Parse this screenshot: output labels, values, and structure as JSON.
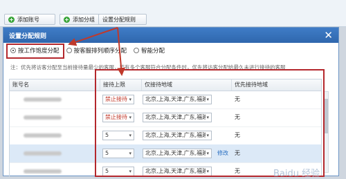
{
  "toolbar": {
    "add_account": "添加账号",
    "add_group": "添加分组",
    "set_rule": "设置分配规则"
  },
  "dialog": {
    "title": "设置分配规则",
    "close": "✕",
    "options": [
      "按工作饱度分配",
      "按客服排列顺序分配",
      "智能分配"
    ],
    "selected": 0,
    "note": "注：优先将访客分配至当前接待量最少的客服，若有多个客服符合分配条件时，优先将访客分配给最久未进行接待的客服"
  },
  "table": {
    "headers": [
      "账号名",
      "接待上限",
      "仅接待地域",
      "优先接待地域"
    ],
    "rows": [
      {
        "limit": "禁止接待",
        "limit_red": true,
        "region": "北京,上海,天津,广东,福建,",
        "priority": "无",
        "edit": ""
      },
      {
        "limit": "禁止接待",
        "limit_red": true,
        "region": "北京,上海,天津,广东,福建,",
        "priority": "无",
        "edit": ""
      },
      {
        "limit": "5",
        "limit_red": false,
        "region": "北京,上海,天津,广东,福建,",
        "priority": "无",
        "edit": ""
      },
      {
        "limit": "5",
        "limit_red": false,
        "region": "北京,上海,天津,广东,福建,",
        "priority": "无",
        "edit": "修改"
      },
      {
        "limit": "5",
        "limit_red": false,
        "region": "北京,上海,天津,广东,福建,",
        "priority": "无",
        "edit": ""
      }
    ]
  },
  "watermark": "Baidu 经验",
  "colors": {
    "accent": "#2f67ad",
    "highlight": "#b4272c",
    "selected_row": "#dce9f7"
  }
}
